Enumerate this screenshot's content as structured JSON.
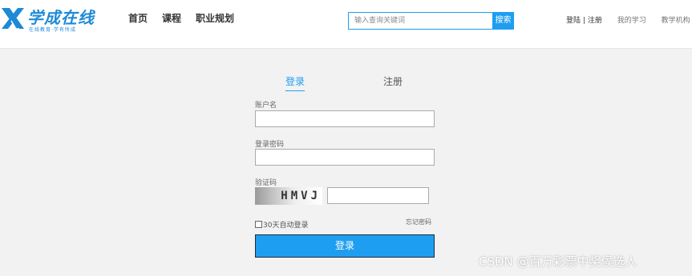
{
  "header": {
    "logo": {
      "title": "学成在线",
      "slogan": "在线教育·学有所成"
    },
    "nav": [
      {
        "label": "首页"
      },
      {
        "label": "课程"
      },
      {
        "label": "职业规划"
      }
    ],
    "search": {
      "placeholder": "输入查询关键词",
      "button_label": "搜索"
    },
    "top_links": {
      "login": "登陆",
      "separator": "|",
      "register": "注册",
      "my_learning": "我的学习",
      "teaching_org": "教学机构"
    }
  },
  "login_form": {
    "tabs": {
      "login": "登录",
      "register": "注册"
    },
    "account_label": "账户名",
    "password_label": "登录密码",
    "captcha_label": "验证码",
    "captcha_text": "HMVJ",
    "remember_label": "30天自动登录",
    "forgot_label": "忘记密码",
    "submit_label": "登录"
  },
  "watermark": "CSDN @百万彩票中奖候选人",
  "colors": {
    "accent": "#1e9ef1",
    "page_background": "#f2f2f2",
    "header_background": "#ffffff"
  }
}
